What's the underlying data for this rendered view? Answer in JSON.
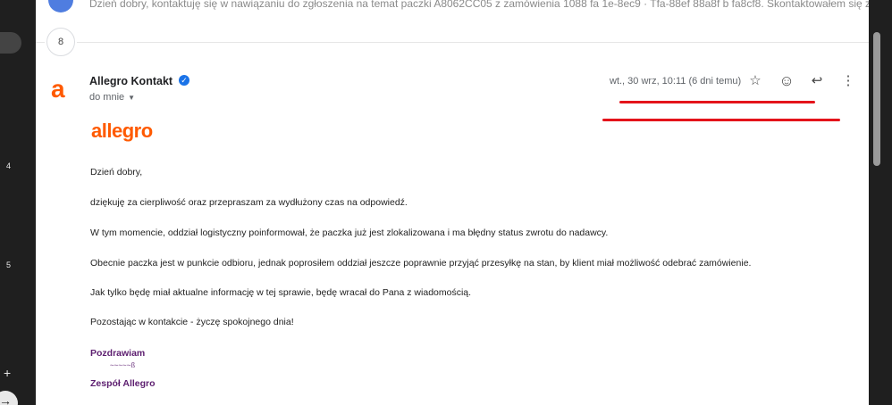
{
  "rail": {
    "numbers": [
      "4",
      "5"
    ],
    "plus": "+",
    "arrow": "→"
  },
  "previous_message": {
    "snippet": "Dzień dobry, kontaktuję się w nawiązaniu do zgłoszenia na temat paczki A8062CC05 z zamówienia 1088 fa 1e-8ec9 · Tfa-88ef 88a8f b fa8cf8. Skontaktowałem się z oddziałe"
  },
  "thread": {
    "count": "8"
  },
  "message": {
    "avatar_letter": "a",
    "sender": "Allegro Kontakt",
    "verified_glyph": "✓",
    "recipient": "do mnie",
    "recipient_caret": "▼",
    "date": "wt., 30 wrz, 10:11 (6 dni temu)",
    "icons": {
      "star": "☆",
      "emoji": "☺",
      "reply": "↩",
      "more": "⋮"
    },
    "logo": "allegro",
    "body": {
      "greeting": "Dzień dobry,",
      "p1": "dziękuję za cierpliwość oraz przepraszam za wydłużony czas na odpowiedź.",
      "p2": "W tym momencie, oddział logistyczny poinformował, że paczka już jest zlokalizowana i ma błędny status zwrotu do nadawcy.",
      "p3": "Obecnie paczka jest w punkcie odbioru, jednak poprosiłem oddział jeszcze poprawnie przyjąć przesyłkę na stan, by klient miał możliwość odebrać zamówienie.",
      "p4": "Jak tylko będę miał aktualne informację w tej sprawie, będę wracał do Pana z wiadomością.",
      "p5": "Pozostając w kontakcie - życzę spokojnego dnia!"
    },
    "signature": {
      "regards": "Pozdrawiam",
      "ghost": "~~~~~ß",
      "team": "Zespół Allegro"
    }
  },
  "colors": {
    "brand": "#ff5a00",
    "annotation": "#e4141b",
    "signature": "#5c1d6f",
    "verified": "#1a73e8"
  }
}
